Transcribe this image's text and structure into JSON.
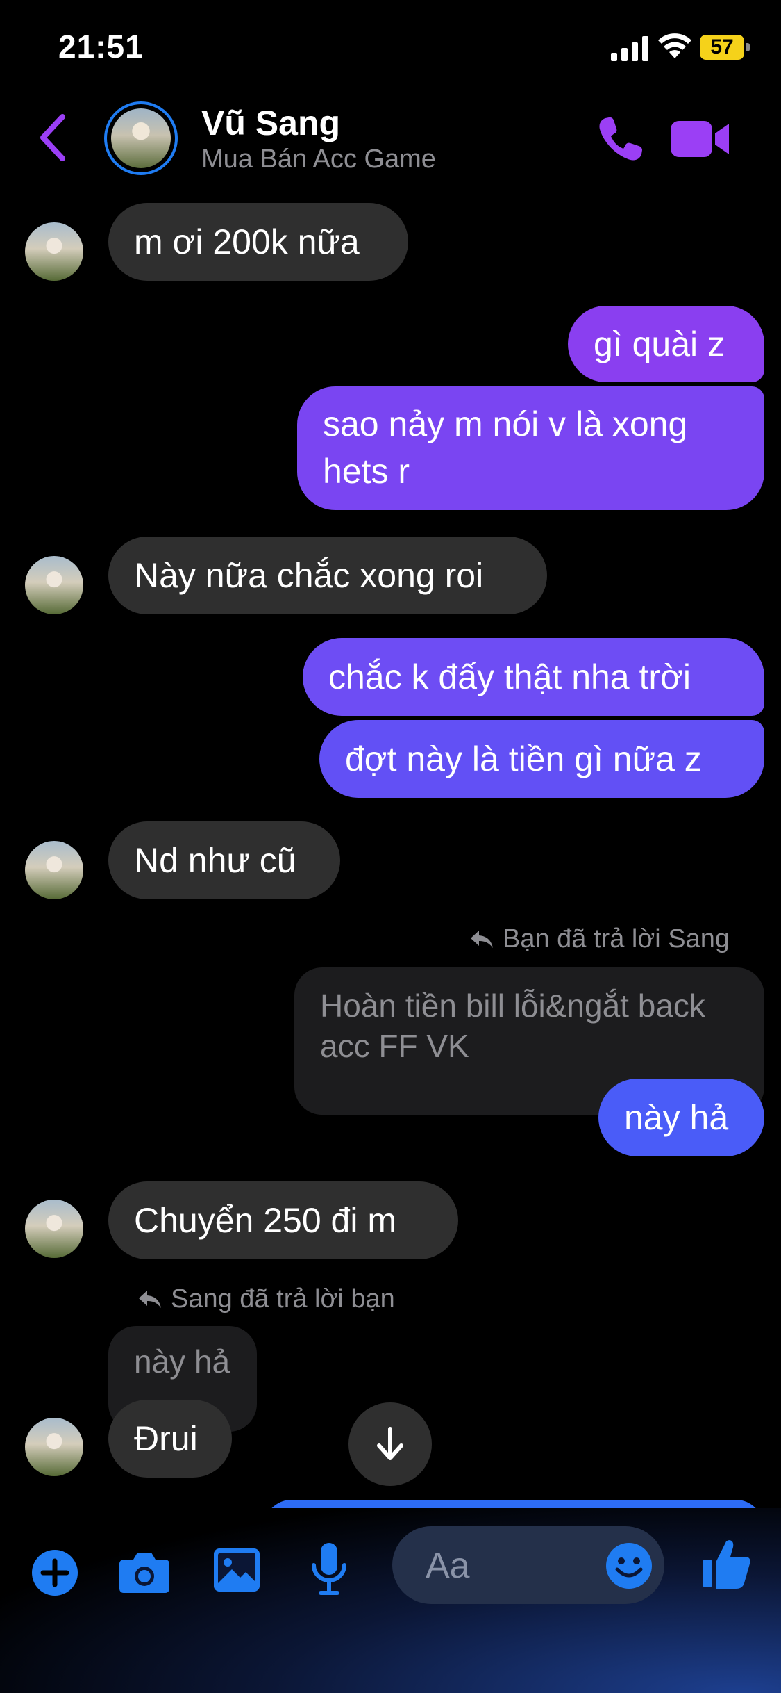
{
  "status_bar": {
    "time": "21:51",
    "battery": "57"
  },
  "header": {
    "contact_name": "Vũ Sang",
    "subtitle": "Mua Bán Acc Game"
  },
  "messages": [
    {
      "id": "m1",
      "text": "m ơi 200k nữa"
    },
    {
      "id": "m2",
      "text": "gì quài z"
    },
    {
      "id": "m3",
      "text": "sao nảy m nói v là xong hets r"
    },
    {
      "id": "m4",
      "text": "Này nữa chắc xong roi"
    },
    {
      "id": "m5",
      "text": "chắc k đấy thật nha trời"
    },
    {
      "id": "m6",
      "text": "đợt này là tiền gì nữa z"
    },
    {
      "id": "m7",
      "text": "Nd như cũ"
    },
    {
      "id": "m8",
      "reply_label": "Bạn đã trả lời Sang",
      "quoted_text": "Hoàn tiền bill lỗi&ngắt back acc FF VK",
      "text": "này hả"
    },
    {
      "id": "m9",
      "text": "Chuyển 250 đi m"
    },
    {
      "id": "m10",
      "reply_label": "Sang đã trả lời bạn",
      "quoted_text": "này hả",
      "text": "Đrui"
    }
  ],
  "composer": {
    "placeholder": "Aa"
  },
  "colors": {
    "accent_purple": "#9b3ff5",
    "accent_blue": "#1f7cf2",
    "incoming_bubble": "#2f2f2f"
  }
}
